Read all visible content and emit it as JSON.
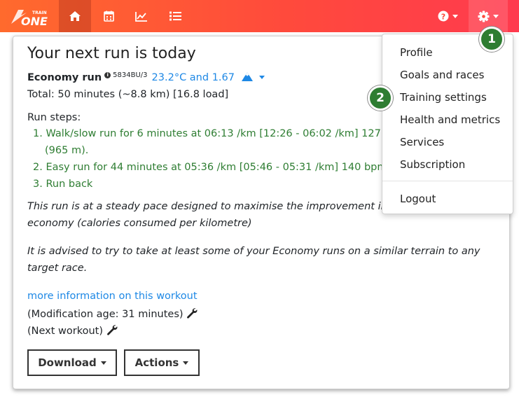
{
  "navbar": {
    "logo_text": "ONE",
    "logo_small": "TRAIN",
    "icons": [
      "home-icon",
      "calendar-icon",
      "chart-icon",
      "list-icon",
      "help-icon",
      "gear-icon"
    ]
  },
  "card": {
    "title": "Your next run is today",
    "run_name": "Economy run",
    "run_code": "5834BU/3",
    "weather": "23.2°C and 1.67",
    "total": "Total: 50 minutes (~8.8 km) [16.8 load]",
    "steps_label": "Run steps:",
    "steps": [
      {
        "num": "1.",
        "line1": "Walk/slow run for 6 minutes at 06:13 /km [12:26 - 06:02 /km] 127 b",
        "line2": "(965 m)."
      },
      {
        "num": "2.",
        "line1": "Easy run for 44 minutes at 05:36 /km [05:46 - 05:31 /km] 140 bpm ("
      },
      {
        "num": "3.",
        "line1": "Run back"
      }
    ],
    "desc1_line1": "This run is at a steady pace designed to maximise the improvement in",
    "desc1_line2": "economy (calories consumed per kilometre)",
    "desc2_line1": "It is advised to try to take at least some of your Economy runs on a similar terrain to any",
    "desc2_line2": "target race.",
    "more_info_link": "more information on this workout",
    "modification_age": "(Modification age: 31 minutes)",
    "next_workout": "(Next workout)",
    "download_label": "Download",
    "actions_label": "Actions"
  },
  "dropdown": {
    "items": [
      "Profile",
      "Goals and races",
      "Training settings",
      "Health and metrics",
      "Services",
      "Subscription"
    ],
    "logout": "Logout"
  },
  "badges": [
    "1",
    "2"
  ],
  "colors": {
    "navbar_start": "#ff6a2d",
    "navbar_end": "#ff3a4e",
    "link_blue": "#1e88e5",
    "step_green": "#2e7d32",
    "badge_green": "#2e7d32"
  }
}
